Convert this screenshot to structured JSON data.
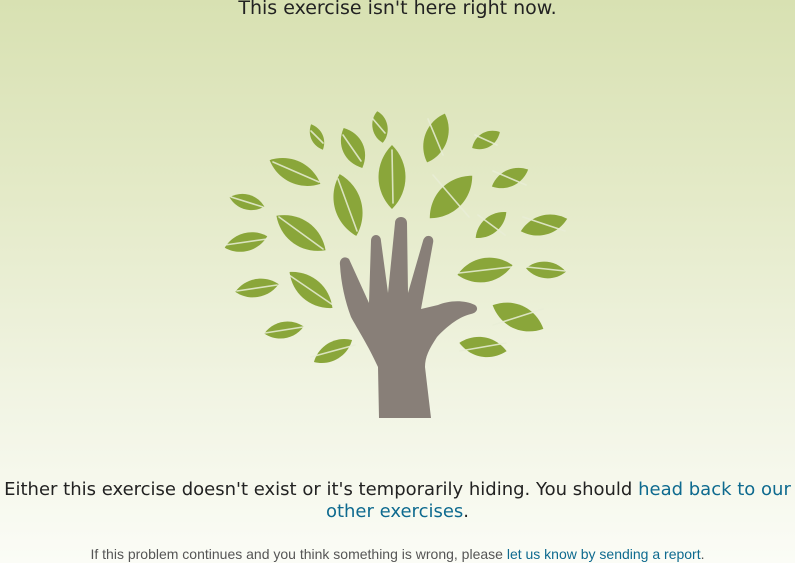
{
  "page": {
    "title": "This exercise isn't here right now."
  },
  "illustration": {
    "icon": "hand-tree-icon",
    "leaf_color": "#8aa63a",
    "hand_color": "#887f78"
  },
  "message": {
    "text_before": "Either this exercise doesn't exist or it's temporarily hiding. You should ",
    "link_label": "head back to our other exercises",
    "text_after": "."
  },
  "report": {
    "text_before": "If this problem continues and you think something is wrong, please ",
    "link_label": "let us know by sending a report",
    "text_after": "."
  },
  "colors": {
    "link": "#0e6a8f",
    "text": "#222222"
  }
}
